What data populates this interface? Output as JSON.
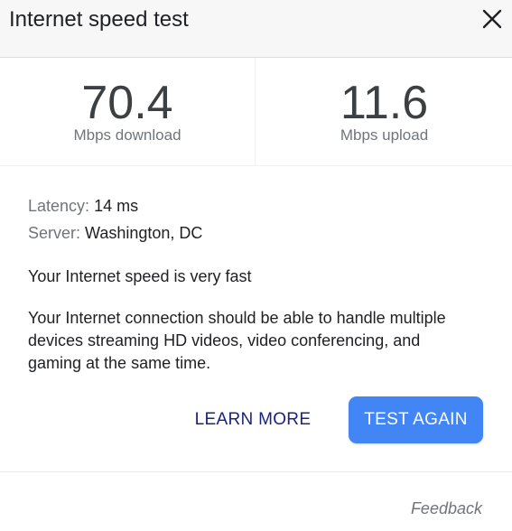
{
  "header": {
    "title": "Internet speed test",
    "close_icon": "close-icon"
  },
  "results": {
    "download": {
      "value": "70.4",
      "unit": "Mbps download"
    },
    "upload": {
      "value": "11.6",
      "unit": "Mbps upload"
    }
  },
  "details": {
    "latency_label": "Latency:",
    "latency_value": "14 ms",
    "server_label": "Server:",
    "server_value": "Washington, DC"
  },
  "verdict": "Your Internet speed is very fast",
  "description": "Your Internet connection should be able to handle multiple devices streaming HD videos, video conferencing, and gaming at the same time.",
  "actions": {
    "learn_more": "LEARN MORE",
    "test_again": "TEST AGAIN"
  },
  "footer": {
    "feedback": "Feedback"
  },
  "colors": {
    "accent": "#4285f4",
    "link": "#1a237e",
    "muted": "#70757a",
    "header_bg": "#f7f7f7"
  }
}
